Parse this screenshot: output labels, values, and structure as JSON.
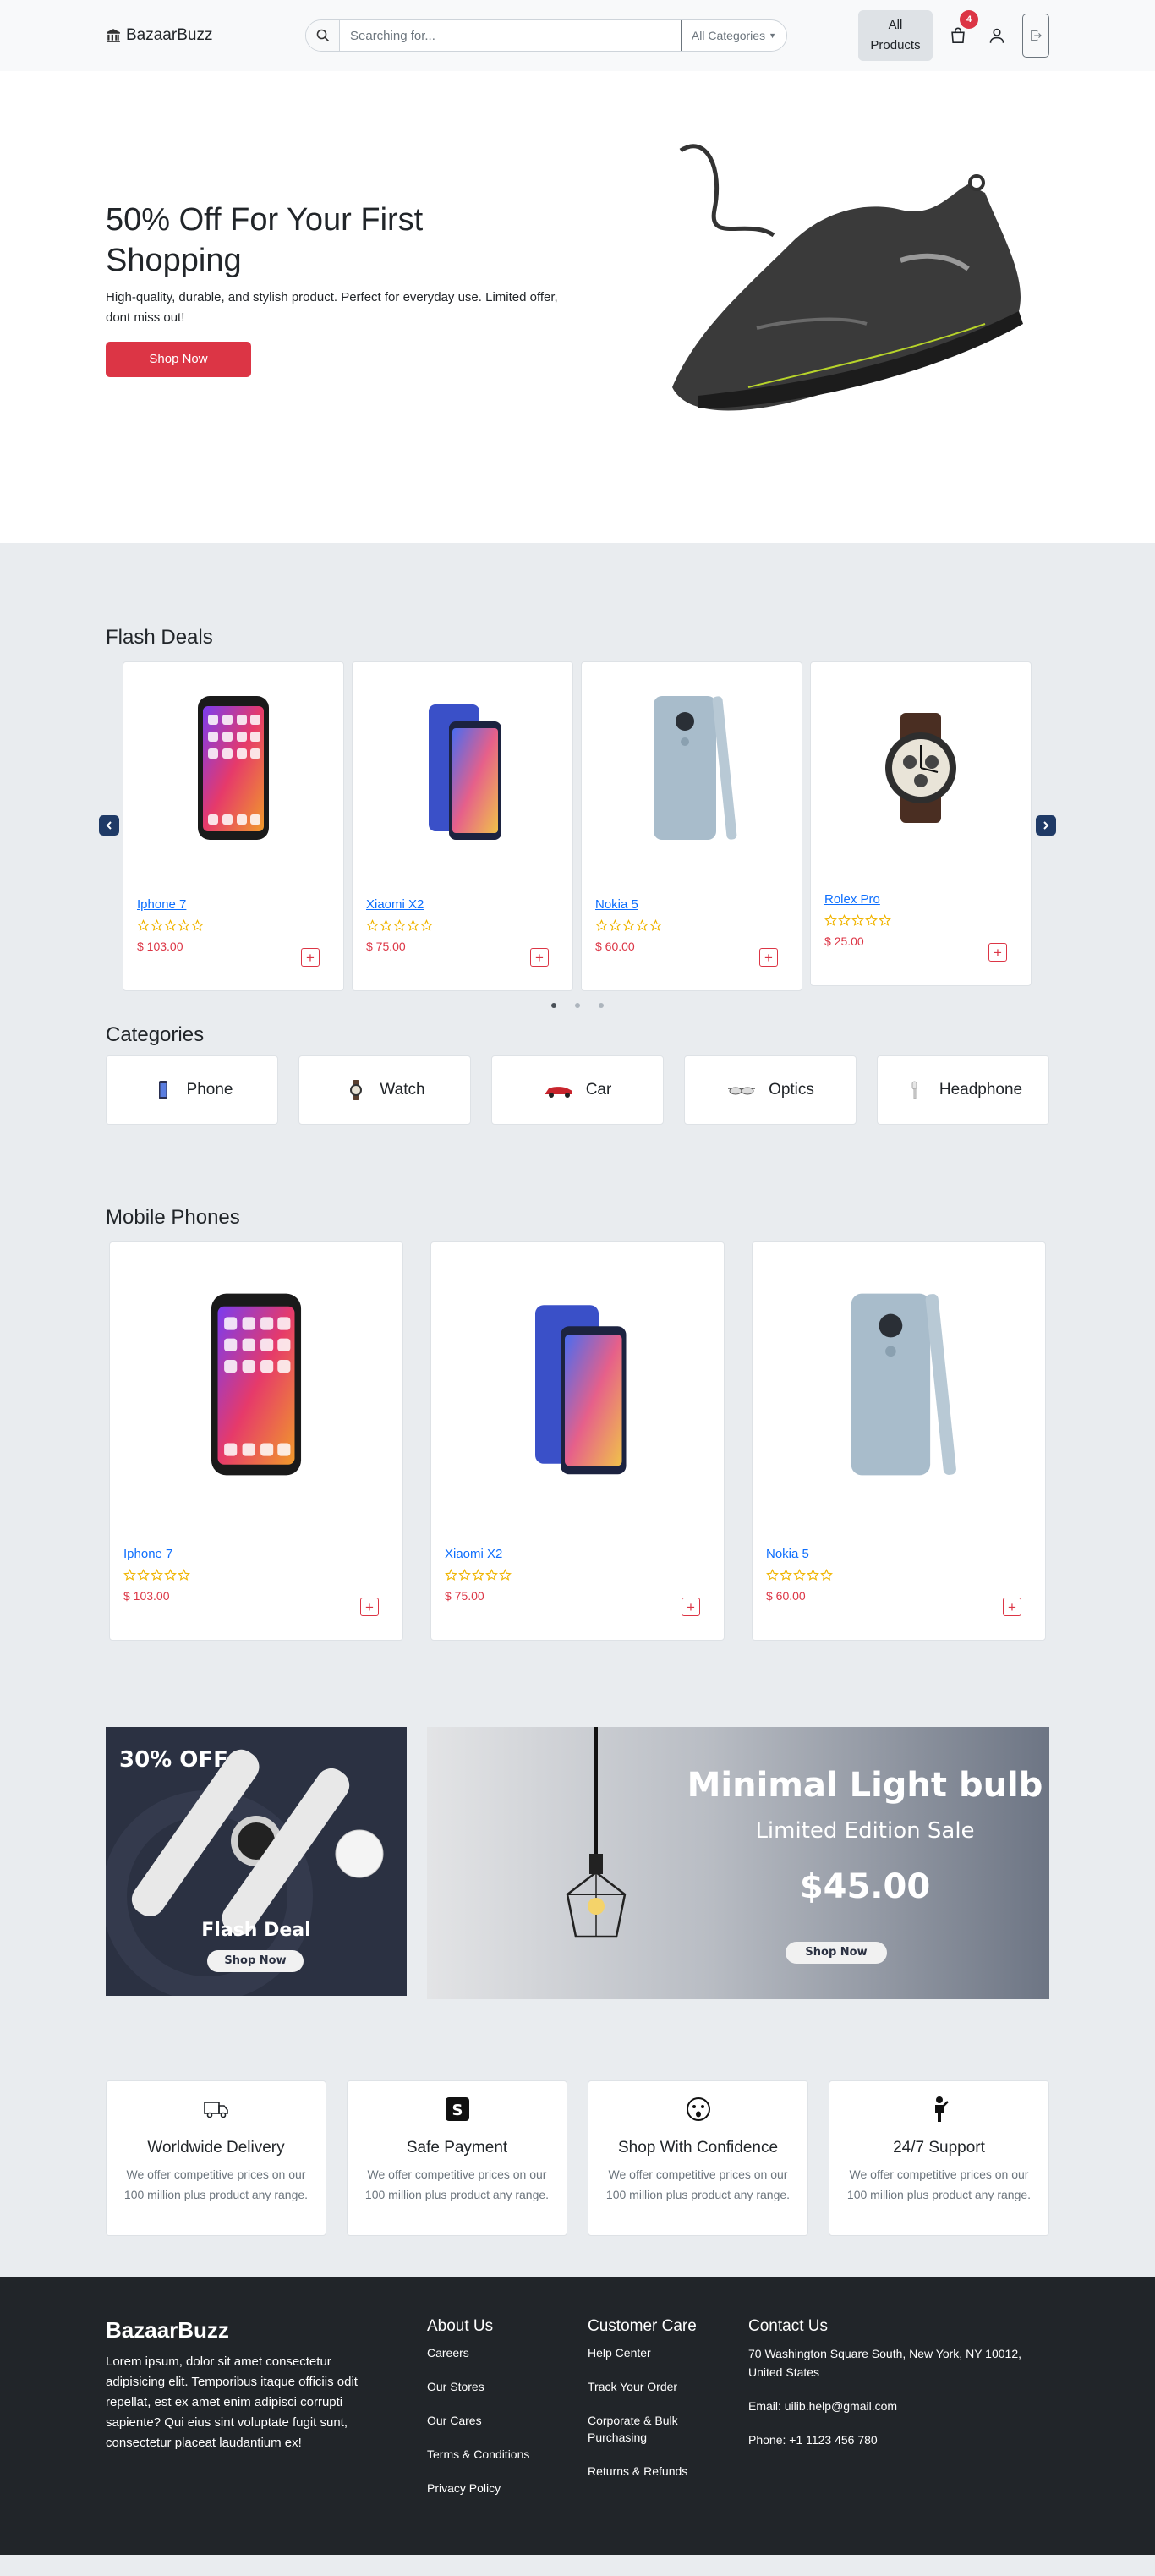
{
  "header": {
    "brand": "BazaarBuzz",
    "search_placeholder": "Searching for...",
    "category_select": "All Categories",
    "all_products_line1": "All",
    "all_products_line2": "Products",
    "cart_count": "4"
  },
  "hero": {
    "title_line1": "50% Off For Your First",
    "title_line2": "Shopping",
    "description": "High-quality, durable, and stylish product. Perfect for everyday use. Limited offer, dont miss out!",
    "button": "Shop Now"
  },
  "flash_deals": {
    "title": "Flash Deals",
    "items": [
      {
        "name": "Iphone 7",
        "price": "$ 103.00",
        "image": "iphone"
      },
      {
        "name": "Xiaomi X2",
        "price": "$ 75.00",
        "image": "xiaomi"
      },
      {
        "name": "Nokia 5",
        "price": "$ 60.00",
        "image": "nokia"
      },
      {
        "name": "Rolex Pro",
        "price": "$ 25.00",
        "image": "watch"
      }
    ],
    "active_slide": 1,
    "slide_count": 3
  },
  "categories": {
    "title": "Categories",
    "items": [
      {
        "label": "Phone",
        "icon": "phone-icon"
      },
      {
        "label": "Watch",
        "icon": "watch-icon"
      },
      {
        "label": "Car",
        "icon": "car-icon"
      },
      {
        "label": "Optics",
        "icon": "glasses-icon"
      },
      {
        "label": "Headphone",
        "icon": "headphone-icon"
      }
    ]
  },
  "mobile_phones": {
    "title": "Mobile Phones",
    "items": [
      {
        "name": "Iphone 7",
        "price": "$ 103.00"
      },
      {
        "name": "Xiaomi X2",
        "price": "$ 75.00"
      },
      {
        "name": "Nokia 5",
        "price": "$ 60.00"
      }
    ]
  },
  "promos": {
    "watch": {
      "discount": "30% OFF",
      "title": "Flash Deal",
      "button": "Shop Now"
    },
    "bulb": {
      "title": "Minimal  Light bulb",
      "subtitle": "Limited Edition Sale",
      "price": "$45.00",
      "button": "Shop Now"
    }
  },
  "features": [
    {
      "title": "Worldwide Delivery",
      "text": "We offer competitive prices on our 100 million plus product any range.",
      "icon": "truck-icon"
    },
    {
      "title": "Safe Payment",
      "text": "We offer competitive prices on our 100 million plus product any range.",
      "icon": "payment-icon"
    },
    {
      "title": "Shop With Confidence",
      "text": "We offer competitive prices on our 100 million plus product any range.",
      "icon": "face-icon"
    },
    {
      "title": "24/7 Support",
      "text": "We offer competitive prices on our 100 million plus product any range.",
      "icon": "support-person-icon"
    }
  ],
  "footer": {
    "brand": "BazaarBuzz",
    "about_text": "Lorem ipsum, dolor sit amet consectetur adipisicing elit. Temporibus itaque officiis odit repellat, est ex amet enim adipisci corrupti sapiente? Qui eius sint voluptate fugit sunt, consectetur placeat laudantium ex!",
    "about": {
      "title": "About Us",
      "links": [
        "Careers",
        "Our Stores",
        "Our Cares",
        "Terms & Conditions",
        "Privacy Policy"
      ]
    },
    "care": {
      "title": "Customer Care",
      "links": [
        "Help Center",
        "Track Your Order",
        "Corporate & Bulk Purchasing",
        "Returns & Refunds"
      ]
    },
    "contact": {
      "title": "Contact Us",
      "address": "70 Washington Square South, New York, NY 10012, United States",
      "email": "Email: uilib.help@gmail.com",
      "phone": "Phone: +1 1123 456 780"
    }
  },
  "colors": {
    "accent": "#dc3545",
    "link": "#0d6efd",
    "footer_bg": "#212529",
    "section_bg": "#e9ecef"
  }
}
